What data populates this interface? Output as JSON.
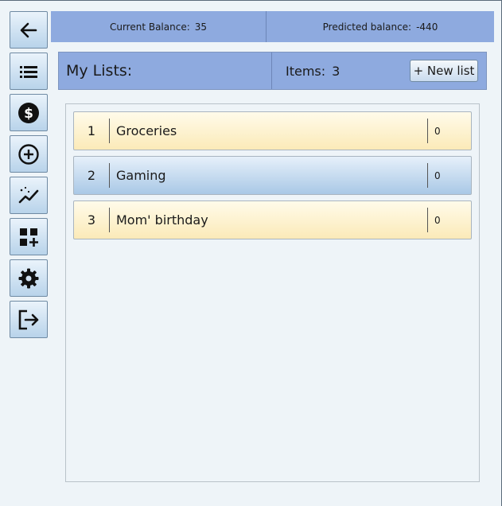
{
  "sidebar": {
    "buttons": [
      {
        "icon": "arrow-left-icon"
      },
      {
        "icon": "list-icon"
      },
      {
        "icon": "dollar-circle-icon"
      },
      {
        "icon": "plus-circle-icon"
      },
      {
        "icon": "trend-chart-icon"
      },
      {
        "icon": "grid-add-icon"
      },
      {
        "icon": "gear-icon"
      },
      {
        "icon": "logout-icon"
      }
    ]
  },
  "balance": {
    "current_label": "Current Balance:",
    "current_value": "35",
    "predicted_label": "Predicted balance:",
    "predicted_value": "-440"
  },
  "header": {
    "title": "My Lists:",
    "items_label": "Items:",
    "items_count": "3",
    "new_list_label": "+ New list"
  },
  "lists": [
    {
      "number": "1",
      "name": "Groceries",
      "count": "0",
      "color": "#fbeab8"
    },
    {
      "number": "2",
      "name": "Gaming",
      "count": "0",
      "color": "#a9c8e6"
    },
    {
      "number": "3",
      "name": "Mom' birthday",
      "count": "0",
      "color": "#fbeab8"
    }
  ],
  "colors": {
    "header_bg": "#8eaadf",
    "page_bg": "#eef4f8"
  }
}
